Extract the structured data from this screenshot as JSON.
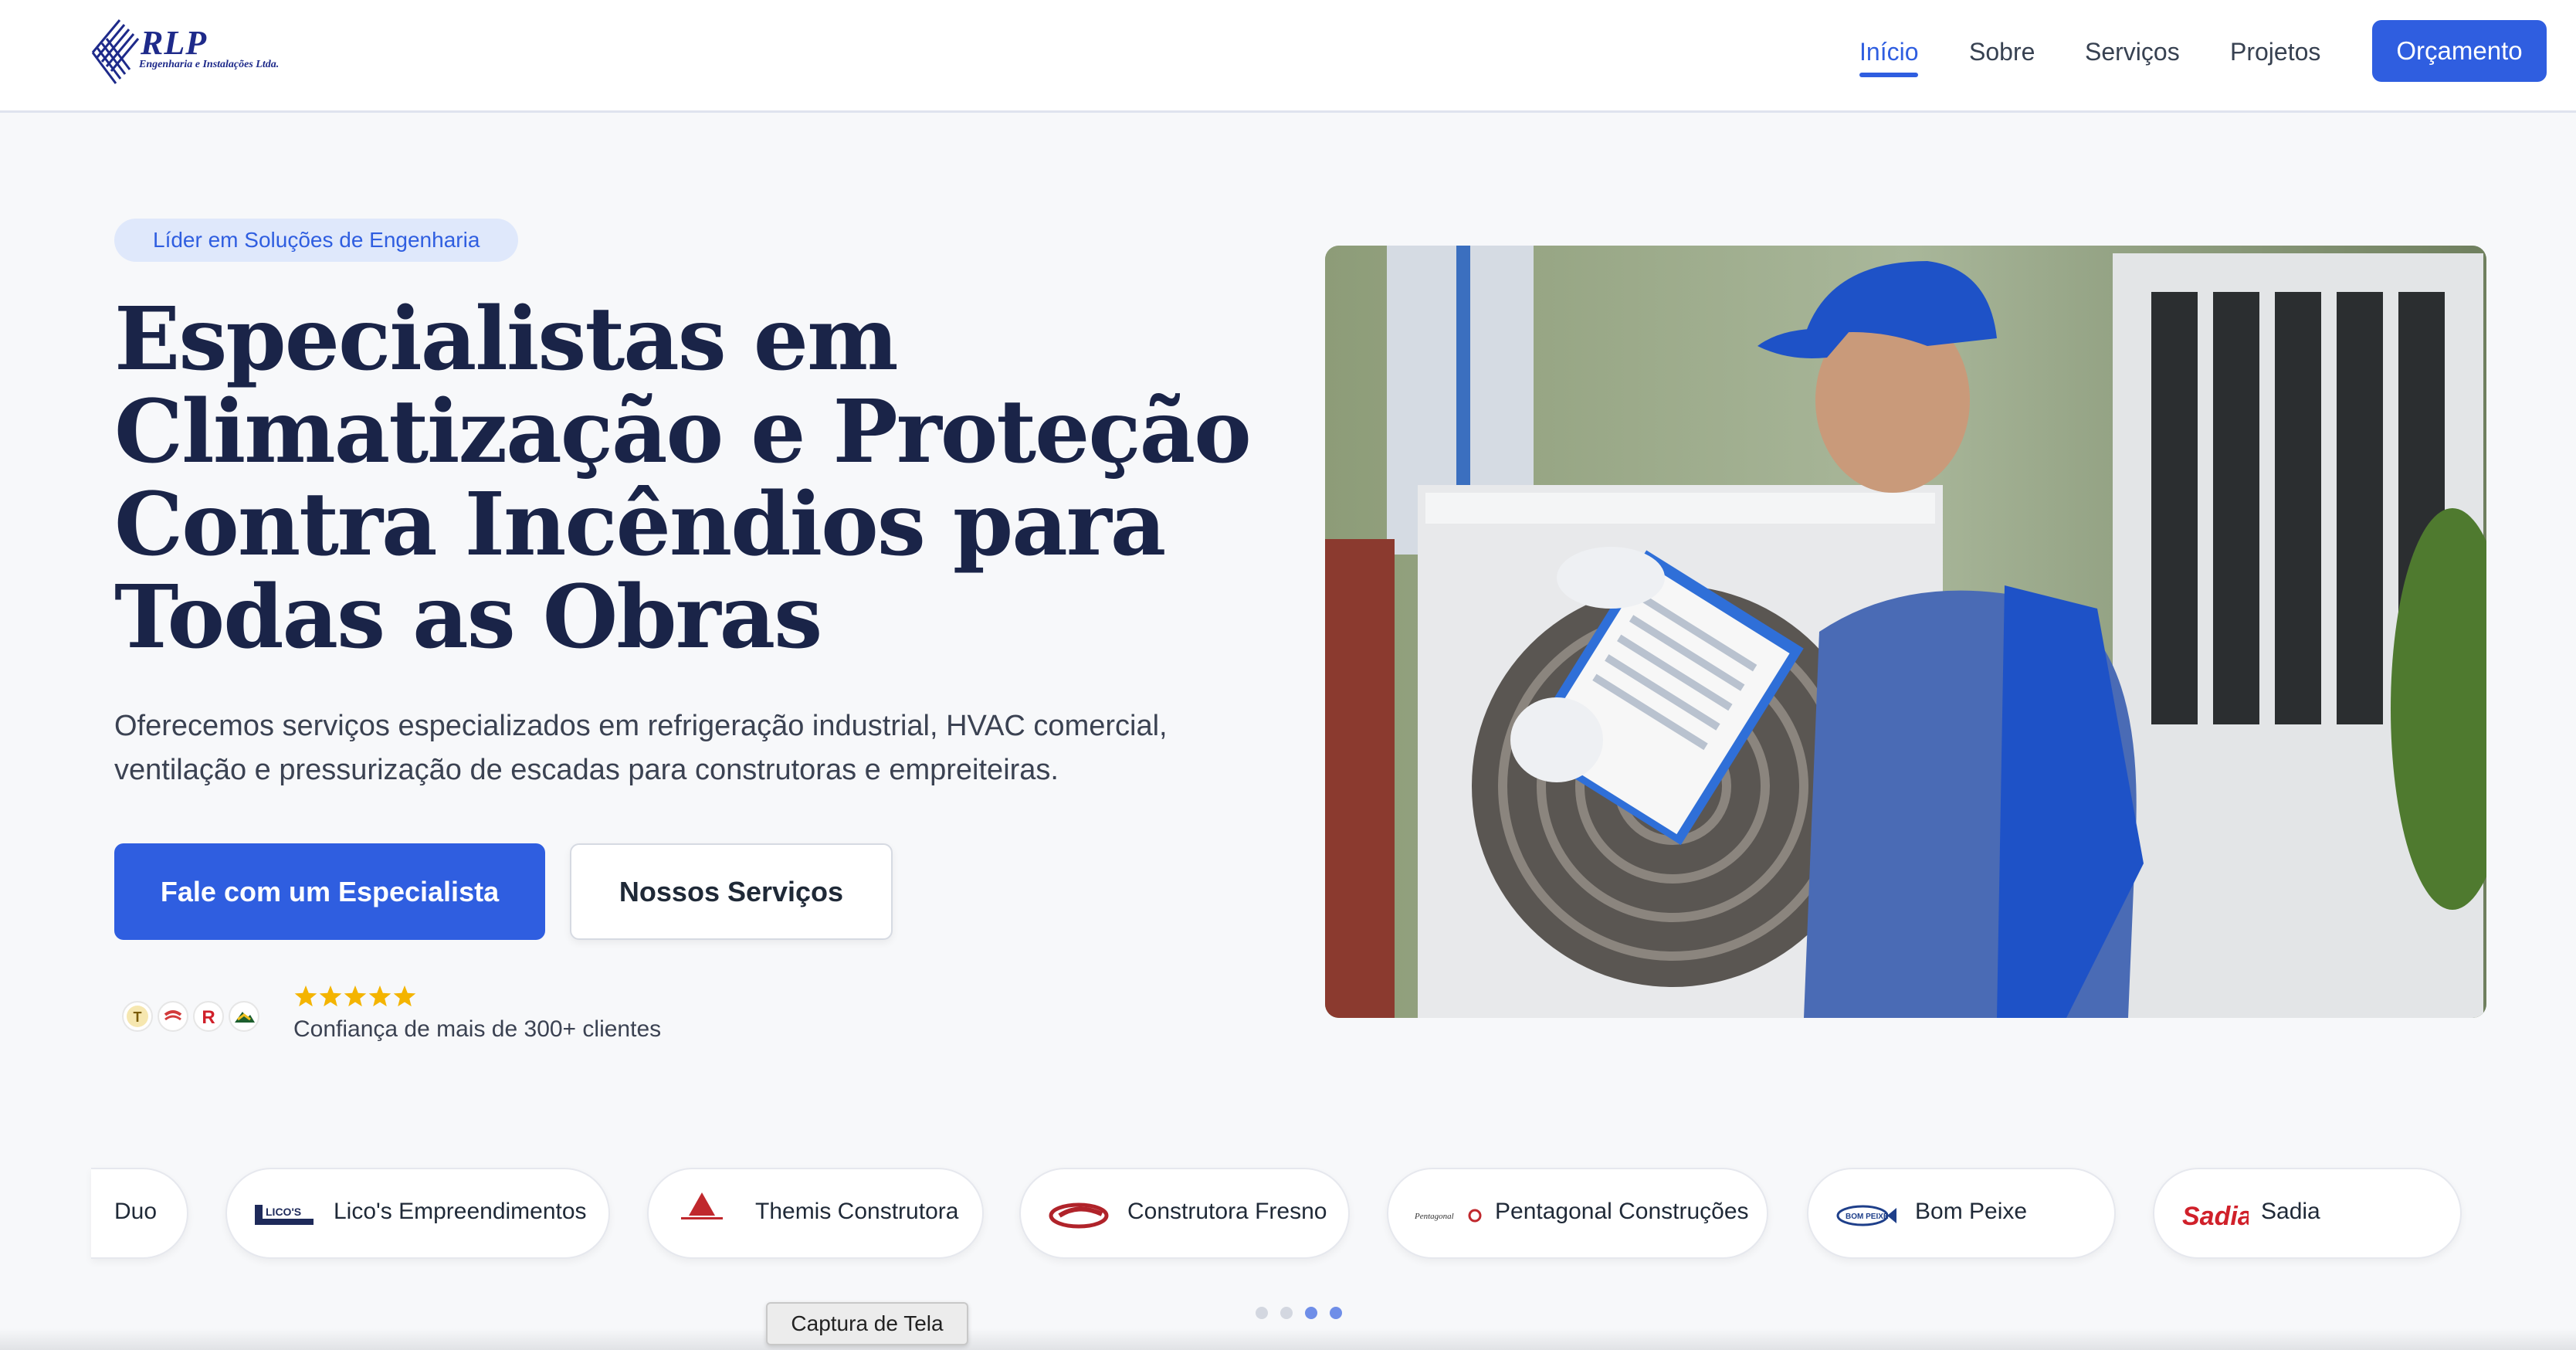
{
  "brand": {
    "name": "RLP",
    "tagline": "Engenharia e Instalações Ltda."
  },
  "nav": {
    "items": [
      {
        "label": "Início",
        "active": true
      },
      {
        "label": "Sobre",
        "active": false
      },
      {
        "label": "Serviços",
        "active": false
      },
      {
        "label": "Projetos",
        "active": false
      }
    ],
    "cta_label": "Orçamento"
  },
  "hero": {
    "badge": "Líder em Soluções de Engenharia",
    "title": "Especialistas em Climatização e Proteção Contra Incêndios para Todas as Obras",
    "subtitle": "Oferecemos serviços especializados em refrigeração industrial, HVAC comercial, ventilação e pressurização de escadas para construtoras e empreiteiras.",
    "primary_cta": "Fale com um Especialista",
    "secondary_cta": "Nossos Serviços",
    "rating_stars": 5,
    "trust_text": "Confiança de mais de 300+ clientes"
  },
  "partners": [
    {
      "name": "Duo"
    },
    {
      "name": "Lico's Empreendimentos",
      "logo_text": "LICO'S"
    },
    {
      "name": "Themis Construtora"
    },
    {
      "name": "Construtora Fresno"
    },
    {
      "name": "Pentagonal Construções",
      "logo_text": "Pentagonal"
    },
    {
      "name": "Bom Peixe",
      "logo_text": "BOM PEIXE"
    },
    {
      "name": "Sadia",
      "logo_text": "Sadia"
    }
  ],
  "carousel": {
    "total": 4,
    "active": [
      2,
      3
    ]
  },
  "tooltip": "Captura de Tela",
  "colors": {
    "accent": "#2f5ee0",
    "title": "#1a2448",
    "badge_bg": "#dfe8fb",
    "star": "#f4b400"
  }
}
